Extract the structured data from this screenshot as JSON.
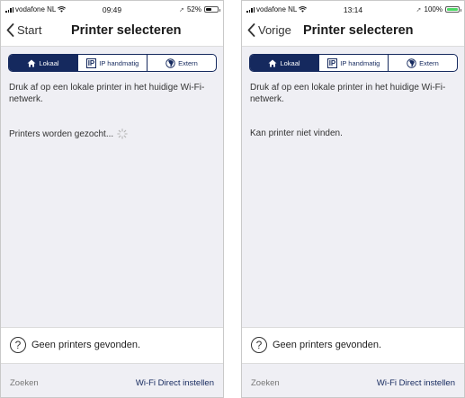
{
  "colors": {
    "accent": "#15295e",
    "background": "#efeff4",
    "battery_charging": "#4cd964"
  },
  "left_phone": {
    "statusbar": {
      "carrier": "vodafone NL",
      "time": "09:49",
      "battery": "52%",
      "battery_level": 0.52
    },
    "nav": {
      "back_label": "Start",
      "title": "Printer selecteren"
    },
    "tabs": [
      {
        "label": "Lokaal",
        "icon": "house-icon"
      },
      {
        "label": "IP handmatig",
        "icon": "ip-icon"
      },
      {
        "label": "Extern",
        "icon": "globe-icon"
      }
    ],
    "description": "Druk af op een lokale printer in het huidige Wi-Fi-netwerk.",
    "status": "Printers worden gezocht...",
    "info": "Geen printers gevonden.",
    "bottom": {
      "left": "Zoeken",
      "right": "Wi-Fi Direct instellen"
    }
  },
  "right_phone": {
    "statusbar": {
      "carrier": "vodafone NL",
      "time": "13:14",
      "battery": "100%",
      "battery_level": 1.0
    },
    "nav": {
      "back_label": "Vorige",
      "title": "Printer selecteren"
    },
    "tabs": [
      {
        "label": "Lokaal",
        "icon": "house-icon"
      },
      {
        "label": "IP handmatig",
        "icon": "ip-icon"
      },
      {
        "label": "Extern",
        "icon": "globe-icon"
      }
    ],
    "description": "Druk af op een lokale printer in het huidige Wi-Fi-netwerk.",
    "status": "Kan printer niet vinden.",
    "info": "Geen printers gevonden.",
    "bottom": {
      "left": "Zoeken",
      "right": "Wi-Fi Direct instellen"
    }
  }
}
